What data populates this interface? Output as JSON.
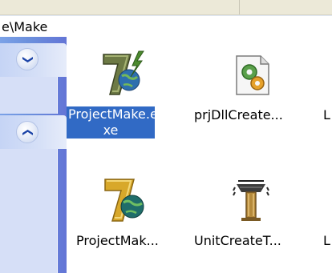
{
  "address": {
    "path": "e\\Make"
  },
  "task_pane": {
    "groups": [
      {
        "toggle_icon": "collapse-chevron-icon",
        "toggle_glyph": "❯"
      },
      {
        "toggle_icon": "expand-chevron-icon",
        "toggle_glyph": "❯"
      }
    ]
  },
  "files": [
    {
      "name_line1": "ProjectMake.e",
      "name_line2": "xe",
      "icon": "app-7-lightning-icon",
      "selected": true
    },
    {
      "name": "prjDllCreate...",
      "icon": "dll-gear-icon",
      "selected": false
    },
    {
      "name": "L",
      "icon": "partial-icon",
      "selected": false
    },
    {
      "name": "ProjectMak...",
      "icon": "app-7-globe-icon",
      "selected": false
    },
    {
      "name": "UnitCreateT...",
      "icon": "unit-column-icon",
      "selected": false
    },
    {
      "name": "L",
      "icon": "partial-icon",
      "selected": false
    }
  ],
  "colors": {
    "selection": "#316ac5",
    "task_pane": "#6b8fdc"
  }
}
